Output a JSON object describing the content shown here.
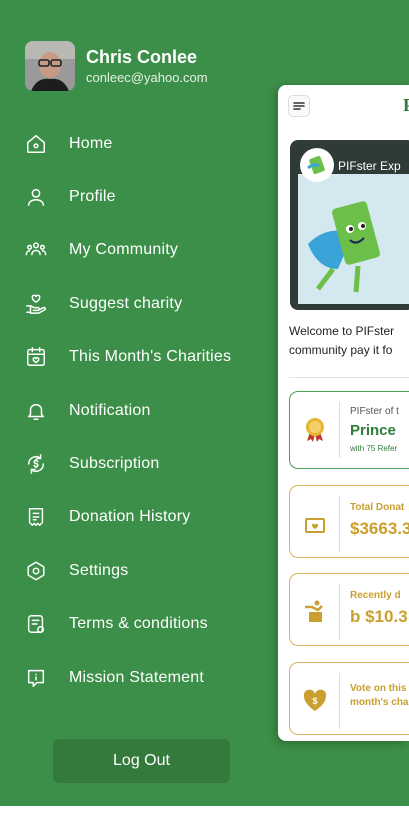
{
  "user": {
    "name": "Chris Conlee",
    "email": "conleec@yahoo.com"
  },
  "menu": [
    {
      "label": "Home",
      "icon": "home-icon"
    },
    {
      "label": "Profile",
      "icon": "user-icon"
    },
    {
      "label": "My Community",
      "icon": "community-icon"
    },
    {
      "label": "Suggest charity",
      "icon": "hand-heart-icon"
    },
    {
      "label": "This Month's Charities",
      "icon": "calendar-heart-icon"
    },
    {
      "label": "Notification",
      "icon": "bell-icon"
    },
    {
      "label": "Subscription",
      "icon": "dollar-refresh-icon"
    },
    {
      "label": "Donation History",
      "icon": "receipt-icon"
    },
    {
      "label": "Settings",
      "icon": "settings-icon"
    },
    {
      "label": "Terms & conditions",
      "icon": "terms-icon"
    },
    {
      "label": "Mission Statement",
      "icon": "info-icon"
    }
  ],
  "logout_label": "Log Out",
  "main": {
    "logo_fragment": "P",
    "video": {
      "title": "PIFster Exp"
    },
    "welcome_line1": "Welcome to PIFster",
    "welcome_line2": "community pay it fo",
    "tiles": {
      "rank": {
        "small": "PIFster of t",
        "big": "Prince",
        "tiny": "with 75 Refer"
      },
      "total": {
        "small": "Total Donat",
        "big": "$3663.3"
      },
      "recent": {
        "small": "Recently d",
        "big": "b $10.3"
      },
      "vote": {
        "line1": "Vote on this",
        "line2": "month's char"
      }
    }
  },
  "colors": {
    "drawer_green": "#3c8f48",
    "accent_gold": "#c9a02f",
    "brand_green": "#2f7d3a"
  }
}
